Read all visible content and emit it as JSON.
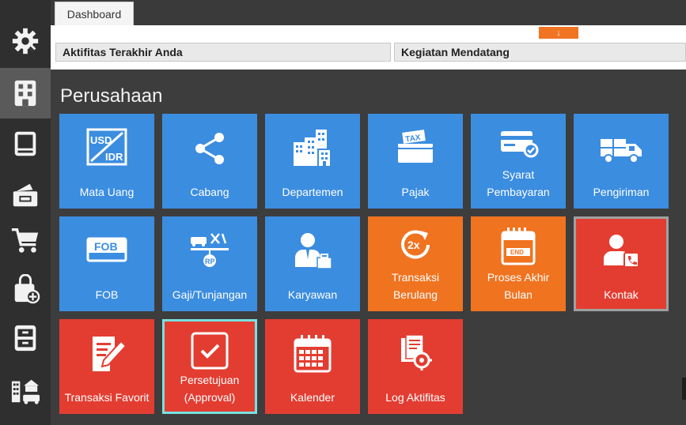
{
  "tabs": [
    {
      "label": "Dashboard"
    }
  ],
  "panels": {
    "left_title": "Aktifitas Terakhir Anda",
    "right_title": "Kegiatan Mendatang"
  },
  "orange_arrow": "↓",
  "section_title": "Perusahaan",
  "sidebar": {
    "items": [
      {
        "icon": "settings-gear-icon"
      },
      {
        "icon": "building-icon"
      },
      {
        "icon": "ledger-book-icon"
      },
      {
        "icon": "wallet-icon"
      },
      {
        "icon": "shopping-cart-icon"
      },
      {
        "icon": "bag-plus-icon"
      },
      {
        "icon": "cabinet-icon"
      },
      {
        "icon": "buildings-car-icon"
      }
    ]
  },
  "tiles": [
    {
      "label": "Mata Uang",
      "icon": "currency-usd-idr-icon",
      "color": "#3b8de0"
    },
    {
      "label": "Cabang",
      "icon": "branch-share-icon",
      "color": "#3b8de0"
    },
    {
      "label": "Departemen",
      "icon": "department-buildings-icon",
      "color": "#3b8de0"
    },
    {
      "label": "Pajak",
      "icon": "tax-ticket-icon",
      "color": "#3b8de0"
    },
    {
      "label_line1": "Syarat",
      "label_line2": "Pembayaran",
      "icon": "payment-card-icon",
      "color": "#3b8de0"
    },
    {
      "label": "Pengiriman",
      "icon": "delivery-truck-icon",
      "color": "#3b8de0"
    },
    {
      "label": "FOB",
      "icon": "fob-label-icon",
      "color": "#3b8de0"
    },
    {
      "label": "Gaji/Tunjangan",
      "icon": "salary-allowance-icon",
      "color": "#3b8de0"
    },
    {
      "label": "Karyawan",
      "icon": "employee-icon",
      "color": "#3b8de0"
    },
    {
      "label_line1": "Transaksi",
      "label_line2": "Berulang",
      "icon": "repeat-2x-icon",
      "color": "#f07320"
    },
    {
      "label_line1": "Proses Akhir",
      "label_line2": "Bulan",
      "icon": "end-calendar-icon",
      "color": "#f07320"
    },
    {
      "label": "Kontak",
      "icon": "contact-person-icon",
      "color": "#e33d32"
    },
    {
      "label": "Transaksi Favorit",
      "icon": "favorite-edit-icon",
      "color": "#e33d32"
    },
    {
      "label_line1": "Persetujuan",
      "label_line2": "(Approval)",
      "icon": "approval-check-icon",
      "color": "#e33d32"
    },
    {
      "label": "Kalender",
      "icon": "calendar-icon",
      "color": "#e33d32"
    },
    {
      "label": "Log Aktifitas",
      "icon": "activity-log-icon",
      "color": "#e33d32"
    }
  ]
}
